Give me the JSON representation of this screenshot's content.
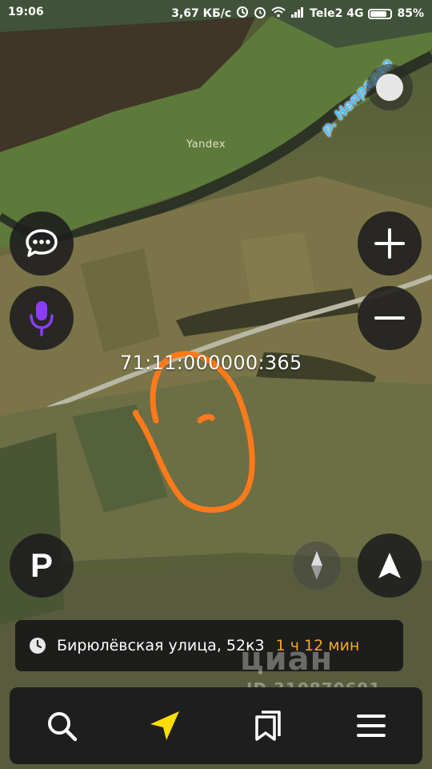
{
  "status_bar": {
    "time": "19:06",
    "speed": "3,67 КБ/с",
    "carrier": "Tele2 4G",
    "battery_percent": "85%",
    "battery_level": 0.85
  },
  "map": {
    "logo": "Yandex",
    "river_label": "р. Непрядва",
    "cadastral_number": "71:11:000000:365"
  },
  "controls": {
    "chat": "chat-bubble-icon",
    "voice": "microphone-icon",
    "zoom_in": "plus-icon",
    "zoom_out": "minus-icon",
    "parking_label": "P",
    "compass": "compass-icon",
    "my_location": "navigation-arrow-icon"
  },
  "route": {
    "address": "Бирюлёвская улица, 52к3",
    "duration": "1 ч 12 мин"
  },
  "watermark": {
    "brand": "циан",
    "id": "ID 310870691"
  },
  "bottom_nav": [
    "search-icon",
    "navigator-arrow-icon",
    "bookmarks-icon",
    "menu-icon"
  ],
  "colors": {
    "accent_orange": "#f5a623",
    "voice_purple": "#8b3cf7",
    "river_blue": "#4fc2ff",
    "outline_orange": "#ff7a1a",
    "nav_yellow": "#ffdd00"
  }
}
